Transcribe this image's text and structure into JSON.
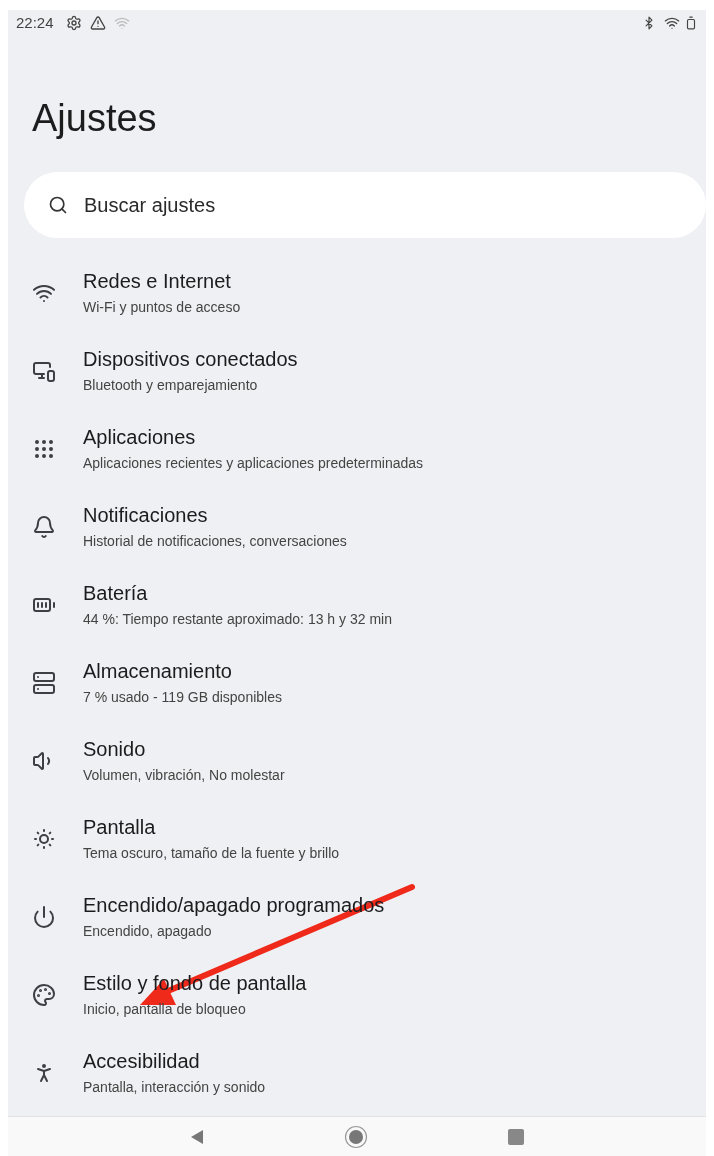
{
  "status_bar": {
    "time": "22:24"
  },
  "title": "Ajustes",
  "search": {
    "placeholder": "Buscar ajustes"
  },
  "items": [
    {
      "title": "Redes e Internet",
      "subtitle": "Wi-Fi y puntos de acceso"
    },
    {
      "title": "Dispositivos conectados",
      "subtitle": "Bluetooth y emparejamiento"
    },
    {
      "title": "Aplicaciones",
      "subtitle": "Aplicaciones recientes y aplicaciones predeterminadas"
    },
    {
      "title": "Notificaciones",
      "subtitle": "Historial de notificaciones, conversaciones"
    },
    {
      "title": "Batería",
      "subtitle": "44 %: Tiempo restante aproximado: 13 h y 32 min"
    },
    {
      "title": "Almacenamiento",
      "subtitle": "7 % usado - 119 GB disponibles"
    },
    {
      "title": "Sonido",
      "subtitle": "Volumen, vibración, No molestar"
    },
    {
      "title": "Pantalla",
      "subtitle": "Tema oscuro, tamaño de la fuente y brillo"
    },
    {
      "title": "Encendido/apagado programados",
      "subtitle": "Encendido, apagado"
    },
    {
      "title": "Estilo y fondo de pantalla",
      "subtitle": "Inicio, pantalla de bloqueo"
    },
    {
      "title": "Accesibilidad",
      "subtitle": "Pantalla, interacción y sonido"
    }
  ]
}
